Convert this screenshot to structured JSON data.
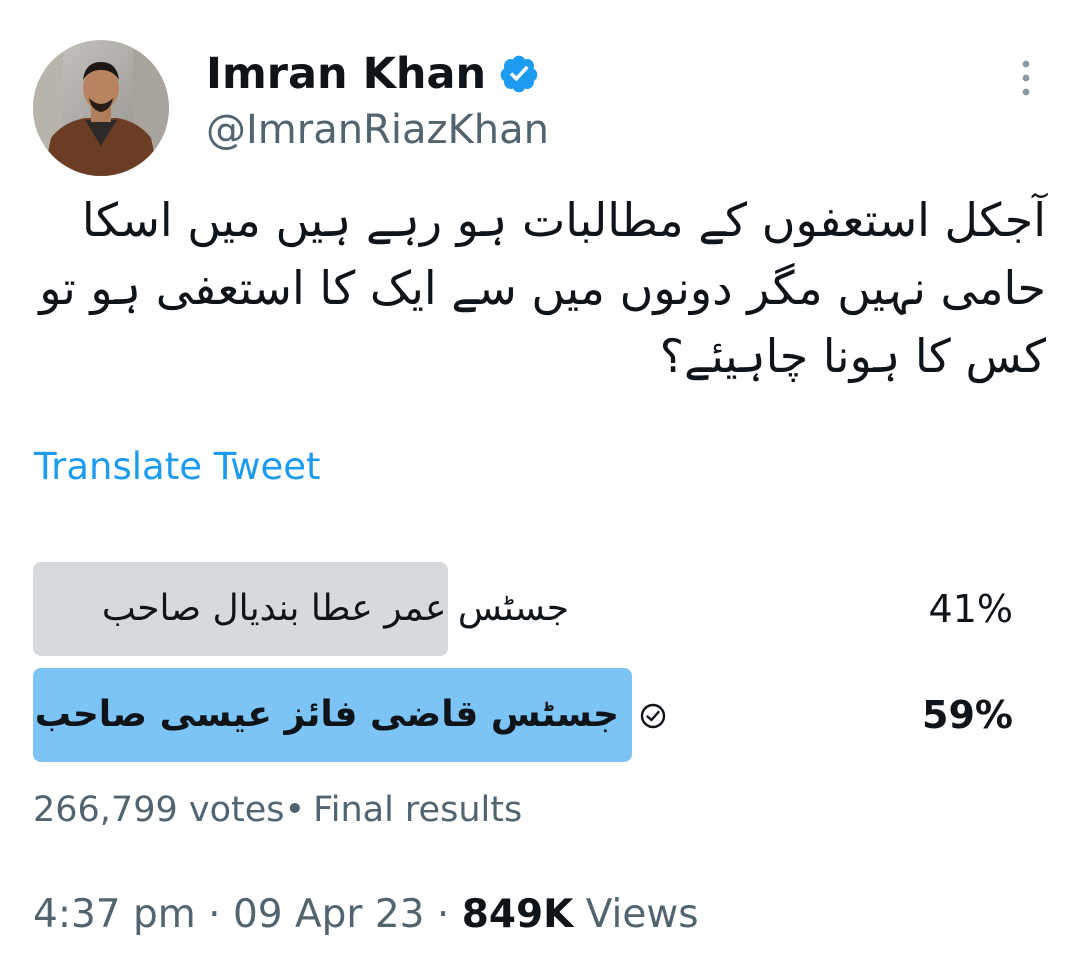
{
  "tweet": {
    "author": {
      "display_name": "Imran Khan",
      "handle": "@ImranRiazKhan",
      "verified_icon": "verified-badge-icon"
    },
    "text_lines": [
      "آجکل استعفوں کے مطالبات ہو رہے ہیں میں اسکا",
      "حامی نہیں مگر دونوں میں سے ایک کا استعفی ہو تو",
      "کس کا ہونا چاہیئے؟"
    ],
    "translate_label": "Translate Tweet",
    "poll": {
      "options": [
        {
          "label": "جسٹس عمر عطا بندیال صاحب",
          "percent_text": "41%",
          "percent": 41,
          "winner": false
        },
        {
          "label": "جسٹس قاضی فائز عیسی صاحب",
          "percent_text": "59%",
          "percent": 59,
          "winner": true
        }
      ],
      "votes": "266,799 votes",
      "status": "Final results"
    },
    "time": "4:37 pm",
    "date": "09 Apr 23",
    "views_count": "849K",
    "views_label": "Views"
  },
  "colors": {
    "accent": "#1d9bf0",
    "winner_bar": "#7cc4f5",
    "loser_bar": "#d6dadd",
    "muted_text": "#536471",
    "primary_text": "#0f1419"
  }
}
